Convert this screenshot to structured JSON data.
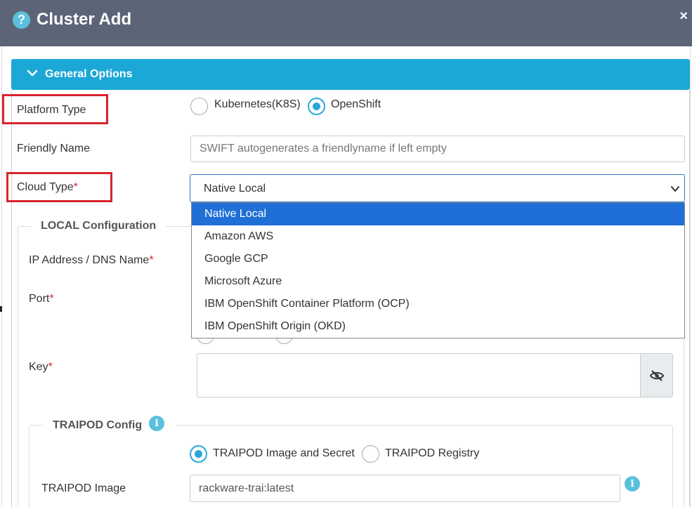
{
  "window": {
    "title": "Cluster Add",
    "close_glyph": "×"
  },
  "section": {
    "title": "General Options"
  },
  "platform": {
    "label": "Platform Type",
    "options": [
      "Kubernetes(K8S)",
      "OpenShift"
    ],
    "selected": "OpenShift"
  },
  "friendly_name": {
    "label": "Friendly Name",
    "value": "",
    "placeholder": "SWIFT autogenerates a friendlyname if left empty"
  },
  "cloud_type": {
    "label": "Cloud Type",
    "required": "*",
    "value": "Native Local",
    "options": [
      "Native Local",
      "Amazon AWS",
      "Google GCP",
      "Microsoft Azure",
      "IBM OpenShift Container Platform (OCP)",
      "IBM OpenShift Origin (OKD)"
    ]
  },
  "local_config": {
    "legend": "LOCAL Configuration",
    "ip_label": "IP Address / DNS Name",
    "port_label": "Port",
    "key_label": "Key",
    "required": "*"
  },
  "traipod": {
    "legend": "TRAIPOD Config",
    "options": [
      "TRAIPOD Image and Secret",
      "TRAIPOD Registry"
    ],
    "selected": "TRAIPOD Image and Secret",
    "image_label": "TRAIPOD Image",
    "image_value": "rackware-trai:latest"
  },
  "icons": {
    "help": "question-circle-icon",
    "close": "close-icon",
    "chevron": "chevron-down-icon",
    "eye": "eye-slash-icon",
    "info": "info-circle-icon"
  },
  "colors": {
    "titlebar": "#5c6478",
    "accent": "#1ca8d6",
    "selected_option": "#1f6fd6",
    "required": "#d9232e",
    "highlight_box": "#d9232e"
  }
}
